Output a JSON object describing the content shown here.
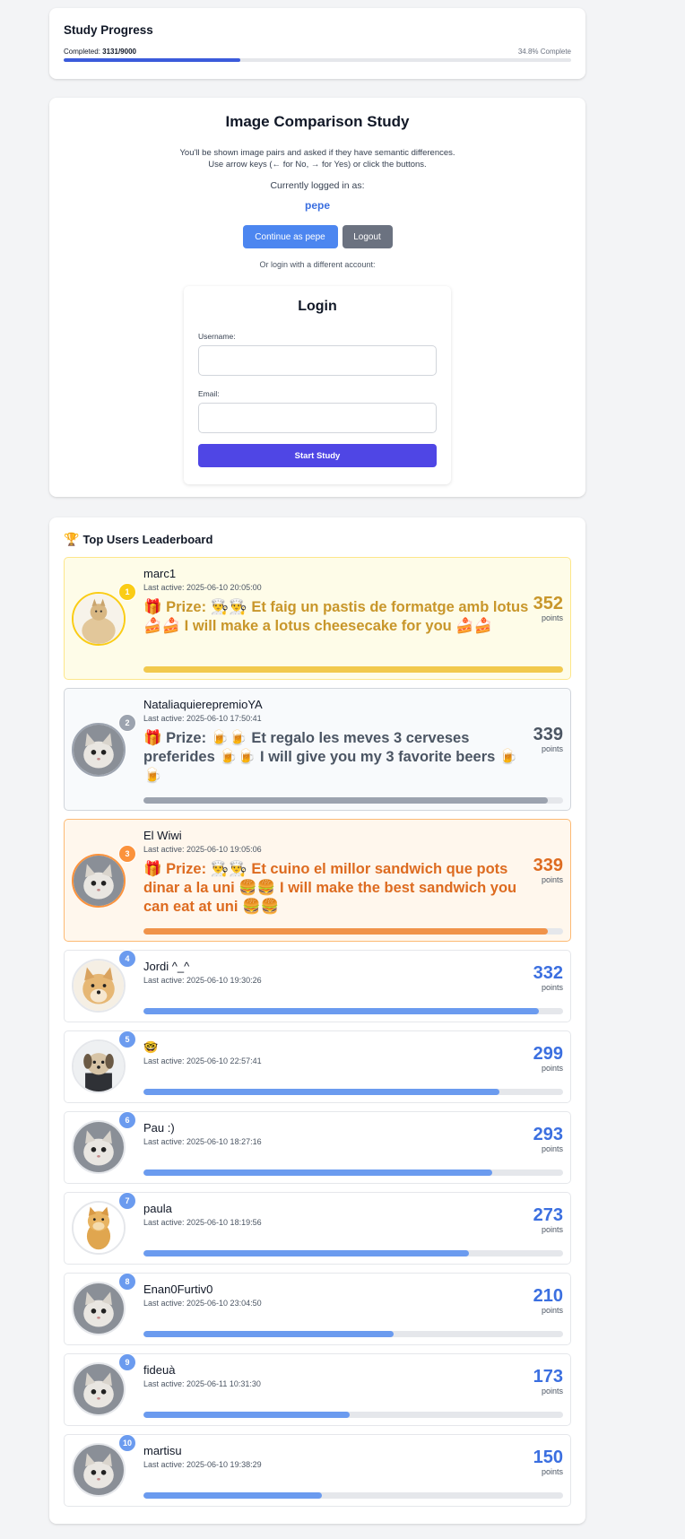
{
  "progress": {
    "title": "Study Progress",
    "completed_label": "Completed:",
    "completed_value": "3131/9000",
    "percent_text": "34.8% Complete",
    "fraction": 0.348
  },
  "study": {
    "title": "Image Comparison Study",
    "intro_line1": "You'll be shown image pairs and asked if they have semantic differences.",
    "intro_line2": "Use arrow keys (← for No, → for Yes) or click the buttons.",
    "logged_in_label": "Currently logged in as:",
    "username": "pepe",
    "continue_label": "Continue as pepe",
    "logout_label": "Logout",
    "or_login_label": "Or login with a different account:",
    "login": {
      "title": "Login",
      "username_label": "Username:",
      "username_value": "",
      "email_label": "Email:",
      "email_value": "",
      "submit_label": "Start Study"
    }
  },
  "leaderboard": {
    "trophy_icon": "🏆",
    "title": "Top Users Leaderboard",
    "points_label": "points",
    "entries": [
      {
        "rank": "1",
        "name": "marc1",
        "last_active": "Last active: 2025-06-10 20:05:00",
        "prize": "🎁 Prize: 👨‍🍳👨‍🍳 Et faig un pastis de formatge amb lotus 🍰🍰 I will make a lotus cheesecake for you 🍰🍰",
        "points": "352",
        "fraction": 1.0,
        "avatar": "buff-doge-avatar",
        "tier": "gold"
      },
      {
        "rank": "2",
        "name": "NataliaquierepremioYA",
        "last_active": "Last active: 2025-06-10 17:50:41",
        "prize": "🎁 Prize: 🍺🍺 Et regalo les meves 3 cerveses preferides 🍺🍺 I will give you my 3 favorite beers 🍺🍺",
        "points": "339",
        "fraction": 0.963,
        "avatar": "cat-avatar",
        "tier": "silver"
      },
      {
        "rank": "3",
        "name": "El Wiwi",
        "last_active": "Last active: 2025-06-10 19:05:06",
        "prize": "🎁 Prize: 👨‍🍳👨‍🍳 Et cuino el millor sandwich que pots dinar a la uni 🍔🍔 I will make the best sandwich you can eat at uni 🍔🍔",
        "points": "339",
        "fraction": 0.963,
        "avatar": "cat-avatar",
        "tier": "bronze"
      },
      {
        "rank": "4",
        "name": "Jordi ^_^",
        "last_active": "Last active: 2025-06-10 19:30:26",
        "prize": "",
        "points": "332",
        "fraction": 0.943,
        "avatar": "doge-avatar",
        "tier": "normal"
      },
      {
        "rank": "5",
        "name": "🤓",
        "last_active": "Last active: 2025-06-10 22:57:41",
        "prize": "",
        "points": "299",
        "fraction": 0.849,
        "avatar": "dog-avatar",
        "tier": "normal"
      },
      {
        "rank": "6",
        "name": "Pau :)",
        "last_active": "Last active: 2025-06-10 18:27:16",
        "prize": "",
        "points": "293",
        "fraction": 0.832,
        "avatar": "cat-avatar",
        "tier": "normal"
      },
      {
        "rank": "7",
        "name": "paula",
        "last_active": "Last active: 2025-06-10 18:19:56",
        "prize": "",
        "points": "273",
        "fraction": 0.776,
        "avatar": "cheems-avatar",
        "tier": "normal"
      },
      {
        "rank": "8",
        "name": "Enan0Furtiv0",
        "last_active": "Last active: 2025-06-10 23:04:50",
        "prize": "",
        "points": "210",
        "fraction": 0.597,
        "avatar": "cat-avatar",
        "tier": "normal"
      },
      {
        "rank": "9",
        "name": "fideuà",
        "last_active": "Last active: 2025-06-11 10:31:30",
        "prize": "",
        "points": "173",
        "fraction": 0.491,
        "avatar": "cat-avatar",
        "tier": "normal"
      },
      {
        "rank": "10",
        "name": "martisu",
        "last_active": "Last active: 2025-06-10 19:38:29",
        "prize": "",
        "points": "150",
        "fraction": 0.426,
        "avatar": "cat-avatar",
        "tier": "normal"
      }
    ]
  }
}
